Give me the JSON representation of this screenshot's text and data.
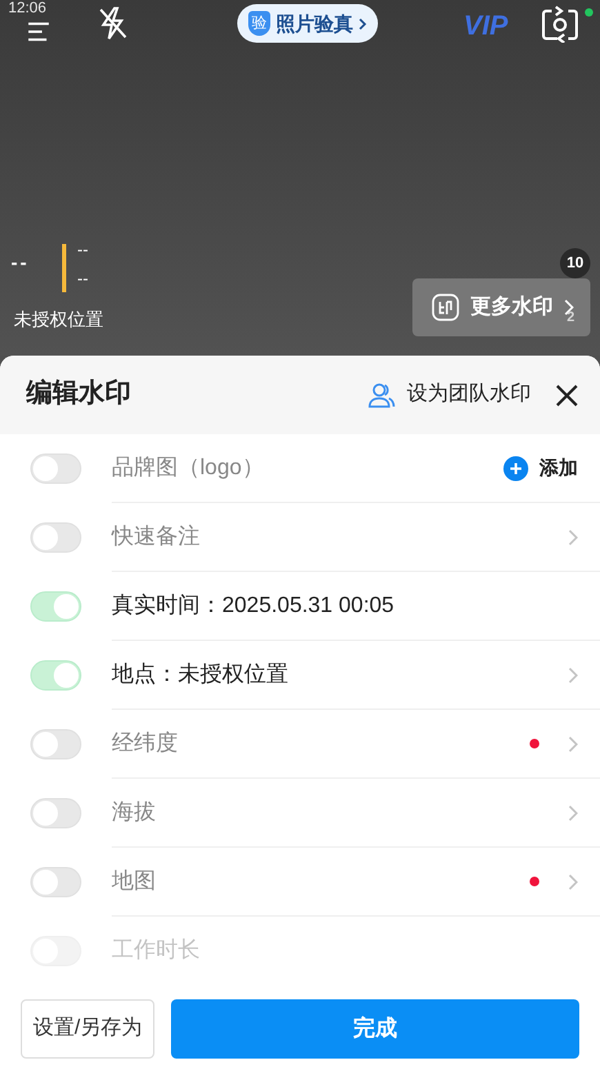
{
  "status_bar": {
    "time": "12:06"
  },
  "camera": {
    "verify_pill": {
      "badge": "验",
      "label": "照片验真"
    },
    "vip": "VIP",
    "watermark_preview": {
      "time": "--",
      "lines": [
        "--",
        "--"
      ],
      "location": "未授权位置"
    },
    "count_badge": "10",
    "more_button": "更多水印",
    "faint_badge": "2"
  },
  "sheet": {
    "title": "编辑水印",
    "team_button": "设为团队水印",
    "rows": [
      {
        "label": "品牌图（logo）",
        "on": false,
        "kind": "add",
        "action": "添加"
      },
      {
        "label": "快速备注",
        "on": false,
        "kind": "chevron"
      },
      {
        "label": "真实时间：2025.05.31 00:05",
        "on": true,
        "kind": "none"
      },
      {
        "label": "地点：未授权位置",
        "on": true,
        "kind": "chevron"
      },
      {
        "label": "经纬度",
        "on": false,
        "kind": "dot"
      },
      {
        "label": "海拔",
        "on": false,
        "kind": "chevron"
      },
      {
        "label": "地图",
        "on": false,
        "kind": "dot"
      },
      {
        "label": "工作时长",
        "on": false,
        "kind": "faded"
      }
    ],
    "buttons": {
      "secondary": "设置/另存为",
      "primary": "完成"
    }
  }
}
